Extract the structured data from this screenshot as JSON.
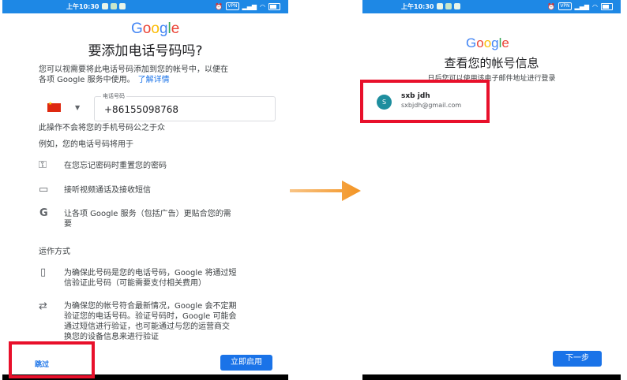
{
  "left": {
    "status_time": "上午10:30",
    "status_vpn": "VPN",
    "google": [
      "G",
      "o",
      "o",
      "g",
      "l",
      "e"
    ],
    "title": "要添加电话号码吗?",
    "intro_a": "您可以视需要将此电话号码添加到您的帐号中，以便在",
    "intro_b": "各项 Google 服务中使用。",
    "learn_more": "了解详情",
    "phone_label": "电话号码",
    "phone_value": "+86155098768",
    "not_public": "此操作不会将您的手机号码公之于众",
    "example": "例如，您的电话号码将用于",
    "use_1": "在您忘记密码时重置您的密码",
    "use_2": "接听视频通话及接收短信",
    "use_3a": "让各项 Google 服务（包括广告）更贴合您的需",
    "use_3b": "要",
    "how_title": "运作方式",
    "how_1a": "为确保此号码是您的电话号码，Google 将通过短",
    "how_1b": "信验证此号码（可能需要支付相关费用）",
    "how_2a": "为确保您的帐号符合最新情况，Google 会不定期",
    "how_2b": "验证您的电话号码。验证号码时，Google 可能会",
    "how_2c": "通过短信进行验证，也可能通过与您的运营商交",
    "how_2d": "换您的设备信息来进行验证",
    "skip_label": "跳过",
    "enable_label": "立即启用"
  },
  "right": {
    "status_time": "上午10:30",
    "status_vpn": "VPN",
    "google": [
      "G",
      "o",
      "o",
      "g",
      "l",
      "e"
    ],
    "title": "查看您的帐号信息",
    "subtitle": "日后您可以使用该电子邮件地址进行登录",
    "avatar_letter": "S",
    "account_name": "sxb jdh",
    "account_email": "sxbjdh@gmail.com",
    "next_label": "下一步"
  },
  "colors": {
    "status_bar": "#1e88e5",
    "highlight": "#e8102b",
    "arrow": "#f39423",
    "primary": "#1a73e8"
  }
}
